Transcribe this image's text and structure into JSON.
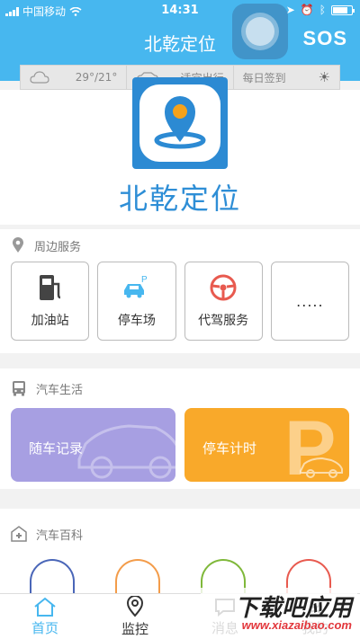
{
  "status": {
    "carrier": "中国移动",
    "time": "14:31"
  },
  "header": {
    "title": "北乾定位",
    "sos_label": "SOS"
  },
  "infobar": {
    "weather": "29°/21°",
    "travel": "适宜出行",
    "checkin": "每日签到"
  },
  "brand": {
    "name": "北乾定位"
  },
  "nearby": {
    "title": "周边服务",
    "items": [
      {
        "label": "加油站"
      },
      {
        "label": "停车场"
      },
      {
        "label": "代驾服务"
      },
      {
        "label": "....."
      }
    ]
  },
  "carlife": {
    "title": "汽车生活",
    "cards": [
      {
        "label": "随车记录"
      },
      {
        "label": "停车计时"
      }
    ]
  },
  "encyclopedia": {
    "title": "汽车百科"
  },
  "tabs": [
    {
      "label": "首页"
    },
    {
      "label": "监控"
    },
    {
      "label": "消息"
    },
    {
      "label": "我的"
    }
  ],
  "watermark": {
    "main": "下载吧应用",
    "sub": "www.xiazaibao.com"
  },
  "colors": {
    "primary": "#47b7ef",
    "brand": "#2e8ed6",
    "card_purple": "#a79fe2",
    "card_orange": "#f9a92a"
  }
}
